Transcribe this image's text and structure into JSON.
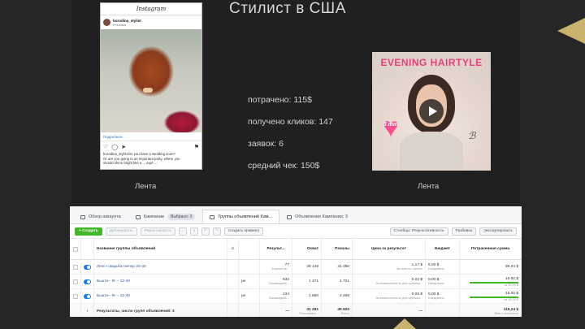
{
  "slide": {
    "title": "Стилист в США",
    "feed_label_left": "Лента",
    "feed_label_right": "Лента",
    "colors": {
      "accent_gold": "#c9b26c",
      "background": "#262626"
    }
  },
  "instagram_post": {
    "header": "Instagram",
    "username": "borodina_stylist",
    "sponsored": "Реклама",
    "more_link": "Подробнее",
    "caption_line1": "borodina_stylist Do you have a wedding soon?",
    "caption_line2": "Or are you going to an important party, where you",
    "caption_line3": "should shine bright like a ... ещё ...",
    "icons": [
      "heart-icon",
      "comment-icon",
      "share-icon",
      "bookmark-icon"
    ]
  },
  "stats": {
    "spent": "потрачено: 115$",
    "clicks": "получено кликов: 147",
    "leads": "заявок: 6",
    "avg_check": "средний чек: 150$"
  },
  "video": {
    "title": "EVENING HAIRTYLE",
    "badge": "5 min",
    "icons": [
      "play-icon",
      "heart-badge-icon"
    ]
  },
  "ads_manager": {
    "tabs": [
      {
        "label": "Обзор аккаунта",
        "icon": "account-icon"
      },
      {
        "label": "Кампании",
        "icon": "folder-icon",
        "pill": "Выбрано: 3"
      },
      {
        "label": "Группы объявлений Кам...",
        "icon": "grid-icon",
        "active": true
      },
      {
        "label": "Объявления Кампании: 3",
        "icon": "ad-icon"
      }
    ],
    "toolbar": {
      "create": "+ Создать",
      "duplicate": "Дублировать",
      "edit": "Редактировать",
      "create_rule": "Создать правило",
      "columns": "Столбцы: Результативность",
      "breakdown": "Разбивка",
      "export": "Экспортировать"
    },
    "columns": {
      "name": "Название группы объявлений",
      "delivery": "",
      "results": "Результ...",
      "reach": "Охват",
      "impressions": "Показы",
      "cost_per_result": "Цена за результат",
      "budget": "Бюджет",
      "amount_spent": "Потраченная сумма"
    },
    "rows": [
      {
        "name": "Лекс+свадьба+вечер 20-40",
        "delivery": "",
        "results": "77",
        "results_sub": "Количеств...",
        "reach": "28 149",
        "impressions": "41 480",
        "cpr": "1,17 $",
        "cpr_sub": "За клик по ссылке",
        "budget": "5,00 $",
        "budget_sub": "Ежедневно",
        "spent": "90,24 $",
        "spent_sub": "",
        "spent_fraction": 0
      },
      {
        "name": "Бьюти-- Ж -- 22-40",
        "delivery": "ре",
        "results": "632",
        "results_sub": "Взаимодейс...",
        "reach": "1 471",
        "impressions": "1 721",
        "cpr": "0,02 $",
        "cpr_sub": "За вовлеченность для публика...",
        "budget": "5,00 $",
        "budget_sub": "Ежедневно",
        "spent": "10,00 $",
        "spent_sub": "из 10,00 $",
        "spent_fraction": 1.0
      },
      {
        "name": "Бьюти-- Ж -- 22-40",
        "delivery": "ре",
        "results": "234",
        "results_sub": "Взаимодейс...",
        "reach": "1 860",
        "impressions": "2 299",
        "cpr": "0,06 $",
        "cpr_sub": "За вовлеченность для публика...",
        "budget": "5,00 $",
        "budget_sub": "Ежедневно",
        "spent": "15,00 $",
        "spent_sub": "из 15,00 $",
        "spent_fraction": 1.0
      }
    ],
    "total_row": {
      "name": "Результаты, число групп объявлений: 3",
      "results": "—",
      "reach": "31 281",
      "reach_sub": "Пользовате...",
      "impressions": "45 500",
      "impressions_sub": "Всего",
      "cpr": "—",
      "budget": "",
      "spent": "115,24 $",
      "spent_sub": "Всего потрачено"
    }
  }
}
